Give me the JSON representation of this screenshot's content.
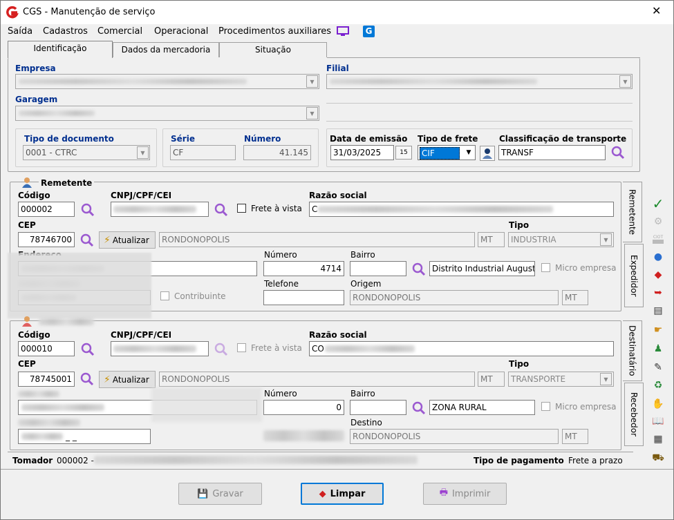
{
  "window": {
    "title": "CGS - Manutenção de serviço",
    "close_glyph": "✕"
  },
  "menu": {
    "items": [
      "Saída",
      "Cadastros",
      "Comercial",
      "Operacional",
      "Procedimentos auxiliares"
    ]
  },
  "tabs": [
    "Identificação",
    "Dados da mercadoria",
    "Situação"
  ],
  "header": {
    "empresa_label": "Empresa",
    "filial_label": "Filial",
    "garagem_label": "Garagem",
    "tipo_doc_label": "Tipo de documento",
    "tipo_doc_value": "0001 - CTRC",
    "serie_label": "Série",
    "serie_value": "CF",
    "numero_label": "Número",
    "numero_value": "41.145",
    "data_emissao_label": "Data de emissão",
    "data_emissao_value": "31/03/2025",
    "calendar_glyph": "15",
    "tipo_frete_label": "Tipo de frete",
    "tipo_frete_value": "CIF",
    "class_transp_label": "Classificação de transporte",
    "class_transp_value": "TRANSF"
  },
  "remetente": {
    "title": "Remetente",
    "codigo_label": "Código",
    "codigo_value": "000002",
    "cnpj_label": "CNPJ/CPF/CEI",
    "frete_vista_label": "Frete à vista",
    "razao_label": "Razão social",
    "razao_prefix": "C",
    "cep_label": "CEP",
    "cep_value": "78746700",
    "atualizar_label": "Atualizar",
    "cidade_value": "RONDONOPOLIS",
    "uf_value": "MT",
    "tipo_label": "Tipo",
    "tipo_value": "INDUSTRIA",
    "endereco_label": "Endereço",
    "numero_label": "Número",
    "numero_value": "4714",
    "bairro_label": "Bairro",
    "bairro_value": "Distrito Industrial Augusto",
    "micro_label": "Micro empresa",
    "contribuinte_label": "Contribuinte",
    "telefone_label": "Telefone",
    "origem_label": "Origem",
    "origem_value": "RONDONOPOLIS",
    "origem_uf": "MT"
  },
  "destinatario": {
    "codigo_label": "Código",
    "codigo_value": "000010",
    "cnpj_label": "CNPJ/CPF/CEI",
    "frete_vista_label": "Frete à vista",
    "razao_label": "Razão social",
    "razao_prefix": "CO",
    "cep_label": "CEP",
    "cep_value": "78745001",
    "atualizar_label": "Atualizar",
    "cidade_value": "RONDONOPOLIS",
    "uf_value": "MT",
    "tipo_label": "Tipo",
    "tipo_value": "TRANSPORTE",
    "numero_label": "Número",
    "numero_value": "0",
    "bairro_label": "Bairro",
    "bairro_value": "ZONA RURAL",
    "micro_label": "Micro empresa",
    "ie_partial": "_ _",
    "destino_label": "Destino",
    "destino_value": "RONDONOPOLIS",
    "destino_uf": "MT"
  },
  "side_tabs": [
    "Remetente",
    "Expedidor",
    "Destinatário",
    "Recebedor"
  ],
  "footer": {
    "tomador_label": "Tomador",
    "tomador_value": "000002 -",
    "tipo_pag_label": "Tipo de pagamento",
    "tipo_pag_value": "Frete a prazo"
  },
  "buttons": {
    "gravar": "Gravar",
    "limpar": "Limpar",
    "imprimir": "Imprimir"
  },
  "colors": {
    "accent": "#002f8f",
    "magnifier": "#9b59d0",
    "brand": "#d62020",
    "app_icon": "#0078d7"
  }
}
